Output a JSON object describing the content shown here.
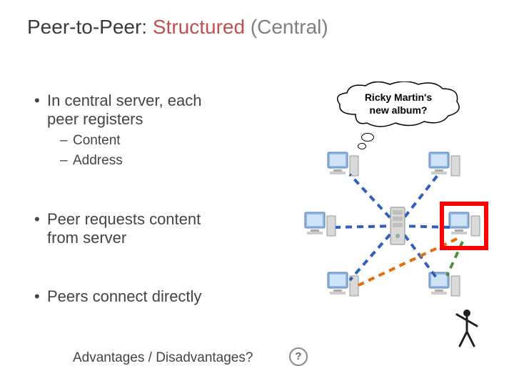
{
  "title": {
    "part1": "Peer-to-Peer: ",
    "accent": "Structured",
    "paren": " (Central)"
  },
  "bullets": {
    "b1_line1": "In central server, each",
    "b1_line2": "peer registers",
    "sub1": "Content",
    "sub2": "Address",
    "b2_line1": "Peer requests content",
    "b2_line2": "from server",
    "b3": "Peers connect directly"
  },
  "footer": {
    "question": "Advantages / Disadvantages?",
    "q_glyph": "?"
  },
  "thought": {
    "line1": "Ricky Martin's",
    "line2": "new album?"
  },
  "chart_data": {
    "type": "diagram",
    "description": "Star topology: one central server connected by dashed blue lines to six peer PCs arranged around it (top-left, top-right, mid-left, mid-right, bottom-left, bottom-right). Two additional dashed connections (orange and green) go from the highlighted mid-right peer to the bottom-left and bottom-right peers respectively, indicating direct peer-to-peer links. A thought bubble from the top-left peer asks about Ricky Martin's new album. A dancing figure appears near the bottom-right peer.",
    "nodes": [
      {
        "id": "server",
        "role": "central-server",
        "pos": "center"
      },
      {
        "id": "peer-tl",
        "role": "peer",
        "pos": "top-left",
        "thought": true
      },
      {
        "id": "peer-tr",
        "role": "peer",
        "pos": "top-right"
      },
      {
        "id": "peer-ml",
        "role": "peer",
        "pos": "mid-left"
      },
      {
        "id": "peer-mr",
        "role": "peer",
        "pos": "mid-right",
        "highlighted": true
      },
      {
        "id": "peer-bl",
        "role": "peer",
        "pos": "bottom-left"
      },
      {
        "id": "peer-br",
        "role": "peer",
        "pos": "bottom-right",
        "dancer_near": true
      }
    ],
    "edges": [
      {
        "from": "server",
        "to": "peer-tl",
        "style": "dashed",
        "color": "#2f5fbf"
      },
      {
        "from": "server",
        "to": "peer-tr",
        "style": "dashed",
        "color": "#2f5fbf"
      },
      {
        "from": "server",
        "to": "peer-ml",
        "style": "dashed",
        "color": "#2f5fbf"
      },
      {
        "from": "server",
        "to": "peer-mr",
        "style": "dashed",
        "color": "#2f5fbf"
      },
      {
        "from": "server",
        "to": "peer-bl",
        "style": "dashed",
        "color": "#2f5fbf"
      },
      {
        "from": "server",
        "to": "peer-br",
        "style": "dashed",
        "color": "#2f5fbf"
      },
      {
        "from": "peer-mr",
        "to": "peer-bl",
        "style": "dashed",
        "color": "#e46c0a"
      },
      {
        "from": "peer-mr",
        "to": "peer-br",
        "style": "dashed",
        "color": "#4f8f3f"
      }
    ]
  }
}
